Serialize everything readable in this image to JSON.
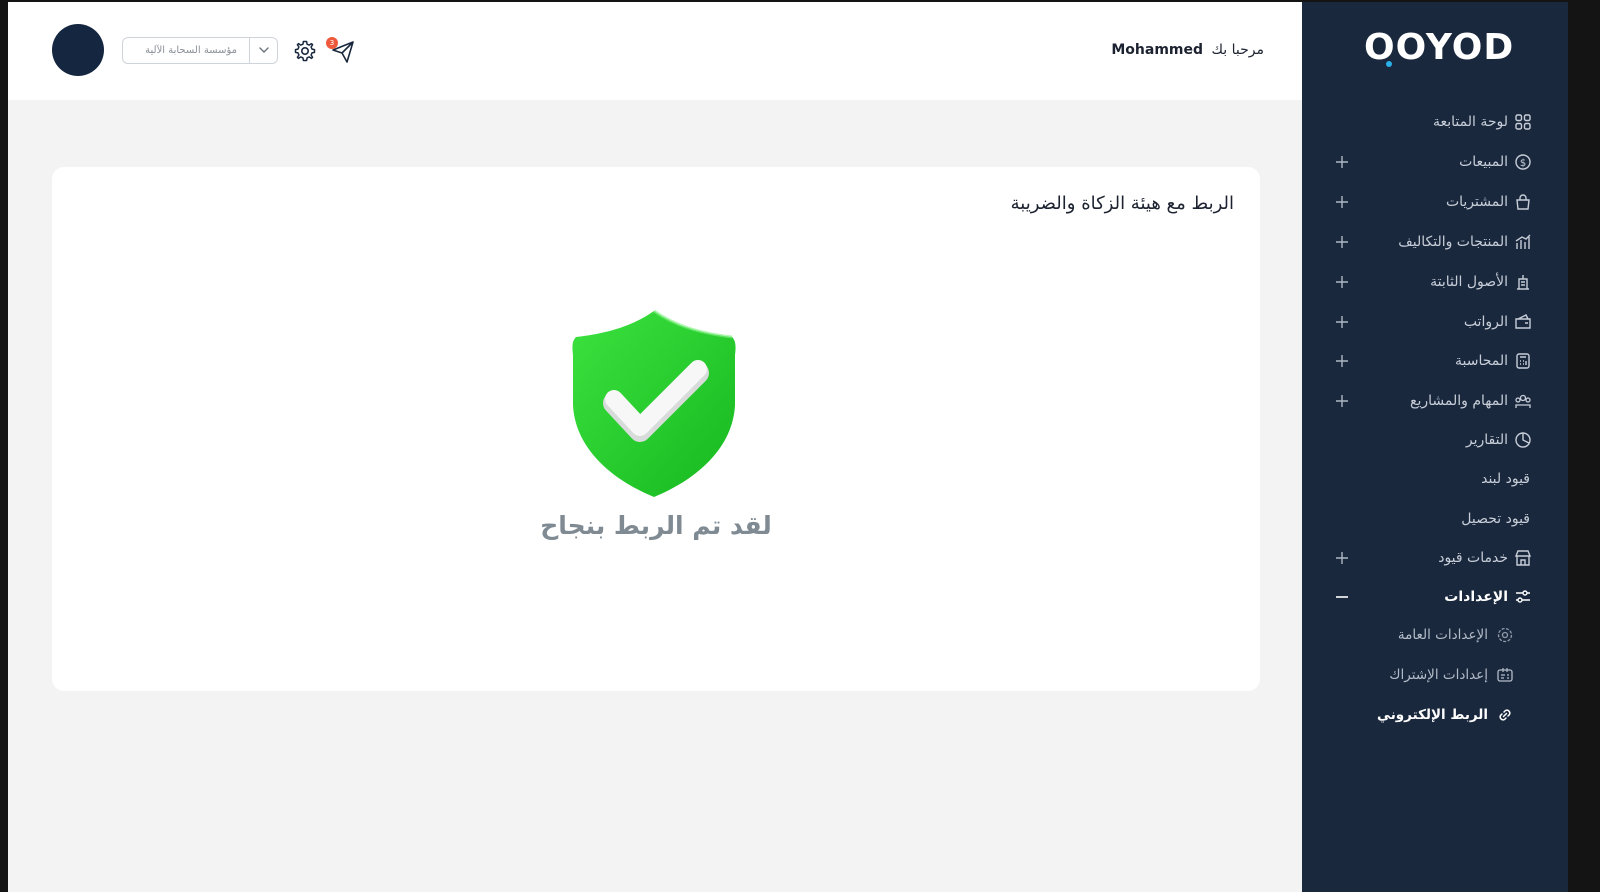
{
  "header": {
    "greeting": "مرحبا بك",
    "user_name": "Mohammed",
    "org_select_value": "مؤسسة السحابة الآلية",
    "notification_count": "3"
  },
  "sidebar": {
    "logo": "OOYOD",
    "items": [
      {
        "label": "لوحة المتابعة",
        "icon": "grid-icon",
        "expandable": false
      },
      {
        "label": "المبيعات",
        "icon": "dollar-circle-icon",
        "expandable": true
      },
      {
        "label": "المشتريات",
        "icon": "bag-icon",
        "expandable": true
      },
      {
        "label": "المنتجات والتكاليف",
        "icon": "chart-bars-icon",
        "expandable": true
      },
      {
        "label": "الأصول الثابتة",
        "icon": "building-icon",
        "expandable": true
      },
      {
        "label": "الرواتب",
        "icon": "wallet-icon",
        "expandable": true
      },
      {
        "label": "المحاسبة",
        "icon": "calculator-icon",
        "expandable": true
      },
      {
        "label": "المهام والمشاريع",
        "icon": "team-icon",
        "expandable": true
      },
      {
        "label": "التقارير",
        "icon": "pie-chart-icon",
        "expandable": false
      },
      {
        "label": "قيود لبند",
        "icon": "",
        "expandable": false
      },
      {
        "label": "قيود تحصيل",
        "icon": "",
        "expandable": false
      },
      {
        "label": "خدمات قيود",
        "icon": "store-icon",
        "expandable": true
      },
      {
        "label": "الإعدادات",
        "icon": "sliders-icon",
        "expandable": true,
        "expanded": true
      }
    ],
    "settings_sub": [
      {
        "label": "الإعدادات العامة",
        "icon": "gear-icon"
      },
      {
        "label": "إعدادات الإشتراك",
        "icon": "id-card-icon"
      },
      {
        "label": "الربط الإلكتروني",
        "icon": "link-icon",
        "current": true
      }
    ]
  },
  "main": {
    "card_title": "الربط مع هيئة الزكاة والضريبة",
    "success_message": "لقد تم الربط بنجاح"
  },
  "colors": {
    "sidebar_bg": "#1a283e",
    "shield_green": "#22d12f",
    "badge": "#ef5a3c",
    "accent_dot": "#2bb0e8"
  }
}
